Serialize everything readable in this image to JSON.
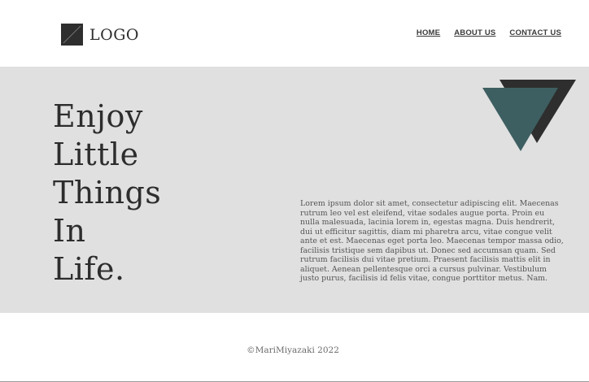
{
  "header": {
    "logo_text": "LOGO",
    "logo_icon": "logo-square-mark",
    "nav": [
      {
        "label": "HOME"
      },
      {
        "label": "ABOUT US"
      },
      {
        "label": "CONTACT US"
      }
    ]
  },
  "hero": {
    "tagline_lines": [
      "Enjoy",
      "Little",
      "Things",
      "In",
      "Life."
    ],
    "body_text": "Lorem ipsum dolor sit amet, consectetur adipiscing elit. Maecenas rutrum leo vel est eleifend, vitae sodales augue porta. Proin eu nulla malesuada, lacinia lorem in, egestas magna. Duis hendrerit, dui ut efficitur sagittis, diam mi pharetra arcu, vitae congue velit ante et est. Maecenas eget porta leo. Maecenas tempor massa odio, facilisis tristique sem dapibus ut. Donec sed accumsan quam. Sed rutrum facilisis dui vitae pretium. Praesent facilisis mattis elit in aliquet. Aenean pellentesque orci a cursus pulvinar. Vestibulum justo purus, facilisis id felis vitae, congue porttitor metus. Nam.",
    "decor": {
      "back_triangle_color": "#2e2e2e",
      "front_triangle_color": "#3e5f61",
      "background_color": "#e0e0e0"
    }
  },
  "footer": {
    "copyright": "©MariMiyazaki 2022"
  }
}
